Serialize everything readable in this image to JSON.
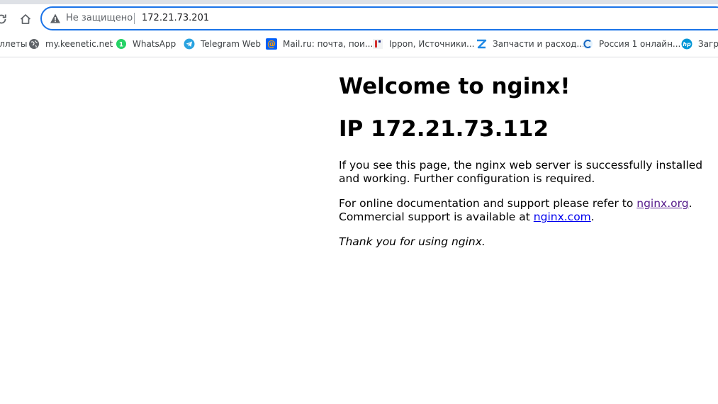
{
  "browser": {
    "omnibox": {
      "security_label": "Не защищено",
      "url": "172.21.73.201"
    },
    "bookmarks": [
      {
        "label": "пеллеты",
        "icon": "bookmark-truncated"
      },
      {
        "label": "my.keenetic.net",
        "icon": "globe-icon"
      },
      {
        "label": "WhatsApp",
        "icon": "whatsapp-icon"
      },
      {
        "label": "Telegram Web",
        "icon": "telegram-icon"
      },
      {
        "label": "Mail.ru: почта, пои...",
        "icon": "mailru-icon"
      },
      {
        "label": "Ippon, Источники...",
        "icon": "ippon-icon"
      },
      {
        "label": "Запчасти и расход...",
        "icon": "zip-icon"
      },
      {
        "label": "Россия 1 онлайн...",
        "icon": "russia1-icon"
      },
      {
        "label": "Загру",
        "icon": "hp-icon"
      }
    ]
  },
  "page": {
    "heading": "Welcome to nginx!",
    "ip_heading": "IP 172.21.73.112",
    "para1": "If you see this page, the nginx web server is successfully installed and working. Further configuration is required.",
    "para2_prefix": "For online documentation and support please refer to ",
    "link_org": "nginx.org",
    "para2_mid": ".\nCommercial support is available at ",
    "link_com": "nginx.com",
    "para2_suffix": ".",
    "para3": "Thank you for using nginx."
  },
  "colors": {
    "omnibox_focus": "#1a73e8",
    "link": "#0000ee",
    "link_visited": "#551a8b",
    "whatsapp": "#25d366",
    "telegram": "#2aa3e0"
  }
}
